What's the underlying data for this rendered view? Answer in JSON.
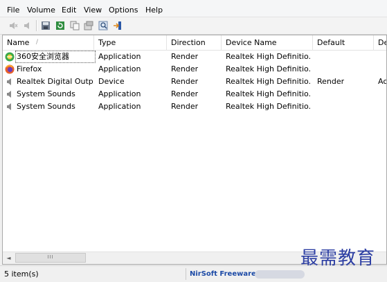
{
  "menu": [
    "File",
    "Volume",
    "Edit",
    "View",
    "Options",
    "Help"
  ],
  "toolbar": {
    "icons": [
      "mute-icon",
      "unmute-icon",
      "save-icon",
      "refresh-icon",
      "copy-icon",
      "properties-icon",
      "find-icon",
      "exit-icon"
    ]
  },
  "columns": [
    "Name",
    "Type",
    "Direction",
    "Device Name",
    "Default",
    "De"
  ],
  "sort_indicator": "/",
  "rows": [
    {
      "icon": "360-browser-icon",
      "name": "360安全浏览器",
      "type": "Application",
      "direction": "Render",
      "device": "Realtek High Definitio...",
      "default": "",
      "extra": ""
    },
    {
      "icon": "firefox-icon",
      "name": "Firefox",
      "type": "Application",
      "direction": "Render",
      "device": "Realtek High Definitio...",
      "default": "",
      "extra": ""
    },
    {
      "icon": "speaker-icon",
      "name": "Realtek Digital Outp...",
      "type": "Device",
      "direction": "Render",
      "device": "Realtek High Definitio...",
      "default": "Render",
      "extra": "Ac"
    },
    {
      "icon": "speaker-icon",
      "name": "System Sounds",
      "type": "Application",
      "direction": "Render",
      "device": "Realtek High Definitio...",
      "default": "",
      "extra": ""
    },
    {
      "icon": "speaker-icon",
      "name": "System Sounds",
      "type": "Application",
      "direction": "Render",
      "device": "Realtek High Definitio...",
      "default": "",
      "extra": ""
    }
  ],
  "scrollbar": {
    "left_arrow": "◄",
    "thumb_grip": "III"
  },
  "status": {
    "count": "5 item(s)",
    "link": "NirSoft Freeware.  h"
  },
  "watermark": "最需教育",
  "colors": {
    "link": "#1c4aa6",
    "watermark": "#2c3ea3"
  }
}
